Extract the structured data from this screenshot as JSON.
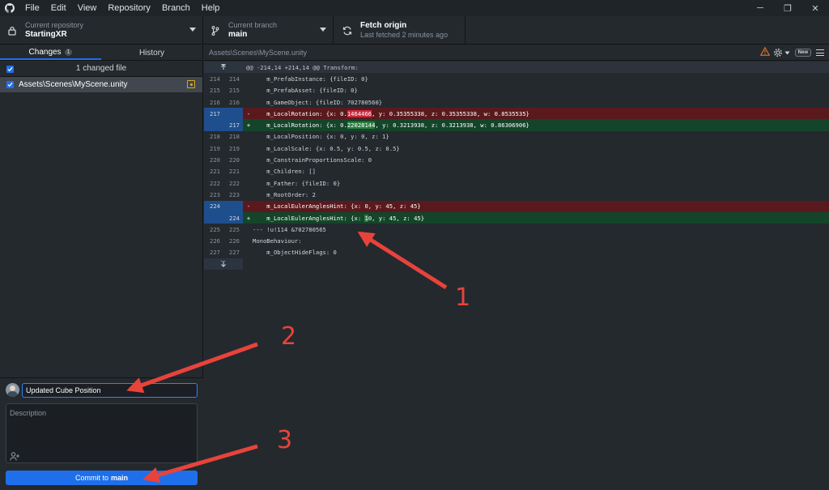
{
  "menubar": {
    "items": [
      "File",
      "Edit",
      "View",
      "Repository",
      "Branch",
      "Help"
    ],
    "window_controls": [
      "─",
      "❐",
      "✕"
    ]
  },
  "toolbar": {
    "repo_label": "Current repository",
    "repo_value": "StartingXR",
    "branch_label": "Current branch",
    "branch_value": "main",
    "fetch_label": "Fetch origin",
    "fetch_sub": "Last fetched 2 minutes ago"
  },
  "sidebar": {
    "tabs": [
      {
        "label": "Changes",
        "count": "1"
      },
      {
        "label": "History"
      }
    ],
    "changed_files_label": "1 changed file",
    "files": [
      {
        "path": "Assets\\Scenes\\MyScene.unity",
        "status_icon": "modified-icon"
      }
    ]
  },
  "commit": {
    "summary_value": "Updated Cube Position",
    "description_placeholder": "Description",
    "button_prefix": "Commit to",
    "button_branch": "main"
  },
  "diff": {
    "path": "Assets\\Scenes\\MyScene.unity",
    "new_badge": "New",
    "hunk_header": "@@ -214,14 +214,14 @@ Transform:",
    "lines": [
      {
        "type": "context",
        "old": "214",
        "new": "214",
        "text": "    m_PrefabInstance: {fileID: 0}"
      },
      {
        "type": "context",
        "old": "215",
        "new": "215",
        "text": "    m_PrefabAsset: {fileID: 0}"
      },
      {
        "type": "context",
        "old": "216",
        "new": "216",
        "text": "    m_GameObject: {fileID: 702780560}"
      },
      {
        "type": "del",
        "old": "217",
        "new": "",
        "pre": "    m_LocalRotation: {x: 0.",
        "hl": "1464466",
        "post": ", y: 0.35355338, z: 0.35355338, w: 0.8535535}"
      },
      {
        "type": "add",
        "old": "",
        "new": "217",
        "pre": "    m_LocalRotation: {x: 0.",
        "hl": "22028144",
        "post": ", y: 0.3213938, z: 0.3213938, w: 0.86306906}"
      },
      {
        "type": "context",
        "old": "218",
        "new": "218",
        "text": "    m_LocalPosition: {x: 0, y: 0, z: 1}"
      },
      {
        "type": "context",
        "old": "219",
        "new": "219",
        "text": "    m_LocalScale: {x: 0.5, y: 0.5, z: 0.5}"
      },
      {
        "type": "context",
        "old": "220",
        "new": "220",
        "text": "    m_ConstrainProportionsScale: 0"
      },
      {
        "type": "context",
        "old": "221",
        "new": "221",
        "text": "    m_Children: []"
      },
      {
        "type": "context",
        "old": "222",
        "new": "222",
        "text": "    m_Father: {fileID: 0}"
      },
      {
        "type": "context",
        "old": "223",
        "new": "223",
        "text": "    m_RootOrder: 2"
      },
      {
        "type": "del",
        "old": "224",
        "new": "",
        "pre": "    m_LocalEulerAnglesHint: {x: 0, y: 45, z: 45}",
        "hl": "",
        "post": ""
      },
      {
        "type": "add",
        "old": "",
        "new": "224",
        "pre": "    m_LocalEulerAnglesHint: {x: ",
        "hl": "1",
        "post": "0, y: 45, z: 45}"
      },
      {
        "type": "context",
        "old": "225",
        "new": "225",
        "text": "--- !u!114 &702780565"
      },
      {
        "type": "context",
        "old": "226",
        "new": "226",
        "text": "MonoBehaviour:"
      },
      {
        "type": "context",
        "old": "227",
        "new": "227",
        "text": "    m_ObjectHideFlags: 0"
      }
    ]
  },
  "annotations": [
    "1",
    "2",
    "3"
  ],
  "colors": {
    "accent": "#1f6feb",
    "deleted_bg": "#5a1a1d",
    "added_bg": "#14452a",
    "arrow": "#e8433b",
    "warning": "#e3752b"
  }
}
